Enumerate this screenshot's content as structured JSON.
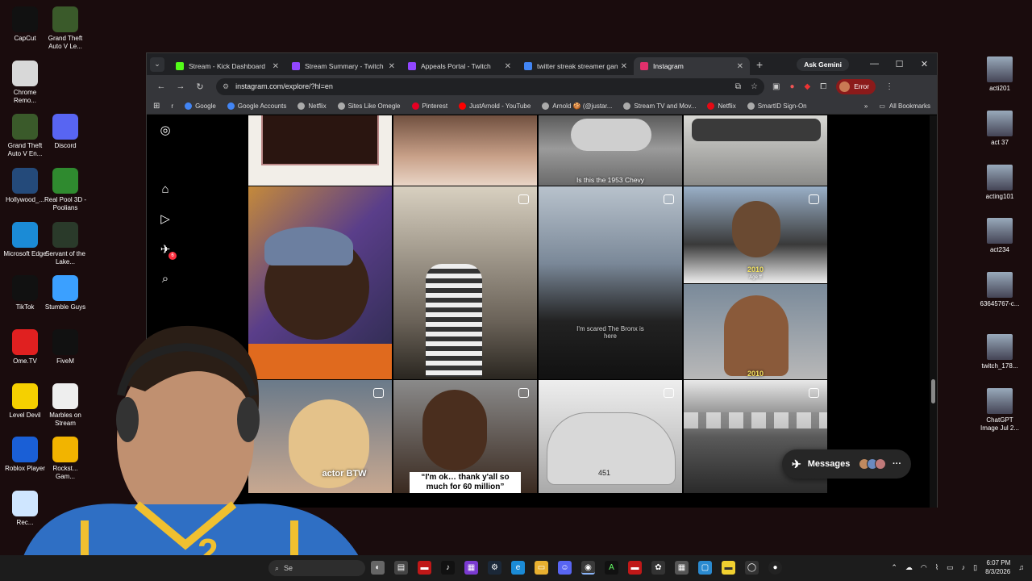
{
  "desktop": {
    "left_icons": [
      {
        "label": "CapCut",
        "icon": "capcut-icon",
        "color": "#111111"
      },
      {
        "label": "Grand Theft Auto V Le...",
        "icon": "gta-icon",
        "color": "#3a5a2a"
      },
      {
        "label": "Chrome Remo...",
        "icon": "chrome-remote-icon",
        "color": "#d8d8d8"
      },
      {
        "label": "Grand Theft Auto V En...",
        "icon": "gta-icon",
        "color": "#3a5a2a"
      },
      {
        "label": "Discord",
        "icon": "discord-icon",
        "color": "#5865f2"
      },
      {
        "label": "Hollywood_...",
        "icon": "image-icon",
        "color": "#244a7a"
      },
      {
        "label": "Real Pool 3D - Poolians",
        "icon": "pool-icon",
        "color": "#2f8a2f"
      },
      {
        "label": "Microsoft Edge",
        "icon": "edge-icon",
        "color": "#1b8bd6"
      },
      {
        "label": "Servant of the Lake...",
        "icon": "game-icon",
        "color": "#2a3a2a"
      },
      {
        "label": "TikTok",
        "icon": "tiktok-icon",
        "color": "#111111"
      },
      {
        "label": "Stumble Guys",
        "icon": "stumble-icon",
        "color": "#3ba0ff"
      },
      {
        "label": "Ome.TV",
        "icon": "ometv-icon",
        "color": "#e02020"
      },
      {
        "label": "FiveM",
        "icon": "fivem-icon",
        "color": "#111111"
      },
      {
        "label": "Level Devil",
        "icon": "level-devil-icon",
        "color": "#f5d000"
      },
      {
        "label": "Marbles on Stream",
        "icon": "marbles-icon",
        "color": "#eeeeee"
      },
      {
        "label": "Roblox Player",
        "icon": "roblox-icon",
        "color": "#1a5fd6"
      },
      {
        "label": "Rockst... Gam...",
        "icon": "rockstar-icon",
        "color": "#f2b400"
      },
      {
        "label": "Rec...",
        "icon": "recycle-bin-icon",
        "color": "#cfe6ff"
      }
    ],
    "right_icons": [
      {
        "label": "acti201",
        "icon": "photo-icon"
      },
      {
        "label": "act 37",
        "icon": "photo-icon"
      },
      {
        "label": "acting101",
        "icon": "photo-icon"
      },
      {
        "label": "act234",
        "icon": "photo-icon"
      },
      {
        "label": "63645767-c...",
        "icon": "photo-icon"
      },
      {
        "label": "twitch_178...",
        "icon": "photo-icon"
      },
      {
        "label": "ChatGPT Image Jul 2...",
        "icon": "photo-icon"
      }
    ]
  },
  "browser": {
    "tabs": [
      {
        "label": "Stream - Kick Dashboard",
        "color": "#53fc18"
      },
      {
        "label": "Stream Summary - Twitch",
        "color": "#9146ff"
      },
      {
        "label": "Appeals Portal - Twitch",
        "color": "#9146ff"
      },
      {
        "label": "twitter streak streamer gam",
        "color": "#4285f4"
      },
      {
        "label": "Instagram",
        "color": "#e1306c"
      }
    ],
    "new_tab": "+",
    "gemini": "Ask Gemini",
    "url": "instagram.com/explore/?hl=en",
    "error_label": "Error",
    "bookmarks": [
      {
        "label": "r",
        "color": "#35363a"
      },
      {
        "label": "Google",
        "color": "#4285f4"
      },
      {
        "label": "Google Accounts",
        "color": "#4285f4"
      },
      {
        "label": "Netflix",
        "color": "#aaaaaa"
      },
      {
        "label": "Sites Like Omegle",
        "color": "#aaaaaa"
      },
      {
        "label": "Pinterest",
        "color": "#e60023"
      },
      {
        "label": "JustArnold - YouTube",
        "color": "#ff0000"
      },
      {
        "label": "Arnold 🍪 (@justar...",
        "color": "#aaaaaa"
      },
      {
        "label": "Stream TV and Mov...",
        "color": "#aaaaaa"
      },
      {
        "label": "Netflix",
        "color": "#e50914"
      },
      {
        "label": "SmartID Sign-On",
        "color": "#aaaaaa"
      }
    ],
    "all_bookmarks": "All Bookmarks"
  },
  "instagram": {
    "notification_count": "6",
    "captions": {
      "chevy": "Is this the 1953 Chevy",
      "year_top": "2010",
      "age_text": "Age ff",
      "year_bottom": "2010",
      "bronx": "I'm scared The Bronx is here",
      "actor": "actor BTW",
      "quote": "“I'm ok… thank y'all so much for 60 million”",
      "plate": "451"
    },
    "messages_label": "Messages"
  },
  "taskbar": {
    "search": "Se",
    "time": "6:07 PM",
    "date": "8/3/2026"
  }
}
